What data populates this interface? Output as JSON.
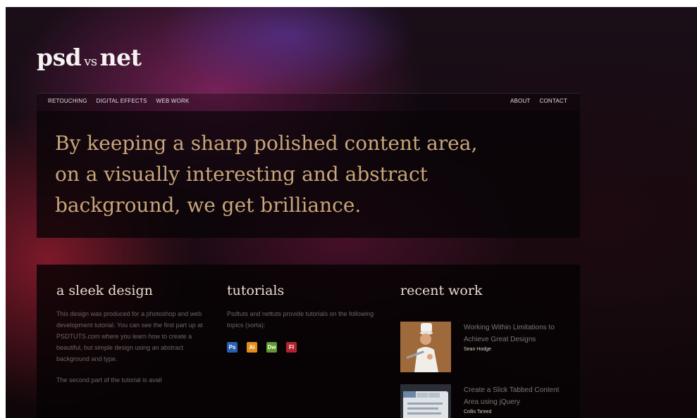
{
  "logo": {
    "part1": "psd",
    "vs": "vs",
    "part2": "net"
  },
  "nav": {
    "left": [
      "RETOUCHING",
      "DIGITAL EFFECTS",
      "WEB WORK"
    ],
    "right": [
      "ABOUT",
      "CONTACT"
    ]
  },
  "hero": {
    "line1": "By keeping a sharp polished content area,",
    "line2": "on a visually interesting and abstract",
    "line3": "background, we get brilliance."
  },
  "columns": {
    "sleek": {
      "title": "a sleek design",
      "p1": "This design was produced for a photoshop and web development tutorial. You can see the first part up at PSDTUTS.com where you learn how to create a beautiful, but simple design using an abstract background and type.",
      "p2": "The second part of the tutorial is avail"
    },
    "tutorials": {
      "title": "tutorials",
      "body": "Psdtuts and nettuts provide tutorials on the following topics (sorta):",
      "icons": [
        {
          "label": "Ps",
          "icon": "photoshop-icon",
          "color": "#2b5fb4"
        },
        {
          "label": "Ai",
          "icon": "illustrator-icon",
          "color": "#e28e1c"
        },
        {
          "label": "Dw",
          "icon": "dreamweaver-icon",
          "color": "#5f9a2a"
        },
        {
          "label": "Fl",
          "icon": "flash-icon",
          "color": "#b3232d"
        }
      ]
    },
    "recent": {
      "title": "recent work",
      "items": [
        {
          "title": "Working Within Limitations to Achieve Great Designs",
          "author": "Sean Hodge"
        },
        {
          "title": "Create a Slick Tabbed Content Area using jQuery",
          "author": "Collis Ta'eed"
        }
      ]
    }
  },
  "colors": {
    "accent": "#c8a679",
    "background": "#140a10"
  }
}
